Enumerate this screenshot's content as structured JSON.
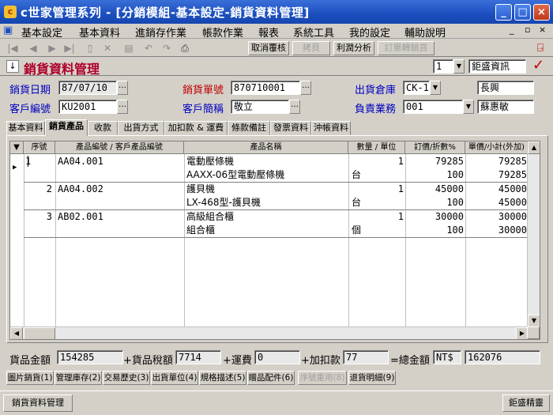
{
  "window": {
    "title": "c世家管理系列 - [分銷模組-基本設定-銷貨資料管理]",
    "app_icon": "c",
    "min_label": "_",
    "max_label": "□",
    "close_label": "×"
  },
  "menu": {
    "items": [
      "基本設定",
      "基本資料",
      "進銷存作業",
      "帳款作業",
      "報表",
      "系統工具",
      "我的設定",
      "輔助說明"
    ],
    "child_controls": [
      "_",
      "▫",
      "×"
    ]
  },
  "toolbar": {
    "icons": [
      "first-record-icon",
      "prev-record-icon",
      "next-record-icon",
      "last-record-icon",
      "new-icon",
      "delete-icon",
      "save-icon",
      "undo-icon",
      "redo-icon",
      "print-icon"
    ],
    "buttons": [
      {
        "label": "取消覆核",
        "enabled": true
      },
      {
        "label": "拷貝",
        "enabled": false
      },
      {
        "label": "利潤分析",
        "enabled": true
      },
      {
        "label": "訂單轉銷貨",
        "enabled": false
      }
    ]
  },
  "header": {
    "title": "銷貨資料管理",
    "record_no": "1",
    "company": "鉅盛資訊",
    "confirm_icon": "✓"
  },
  "form": {
    "sale_date_label": "銷貨日期",
    "sale_date": "87/07/10",
    "sale_no_label": "銷貨單號",
    "sale_no": "870710001",
    "warehouse_label": "出貨倉庫",
    "warehouse": "CK-1",
    "warehouse_name": "長興",
    "customer_no_label": "客戶編號",
    "customer_no": "KU2001",
    "customer_short_label": "客戶簡稱",
    "customer_short": "敬立",
    "sales_rep_label": "負責業務",
    "sales_rep": "001",
    "sales_rep_name": "蘇惠敏"
  },
  "tabs": [
    "基本資料",
    "銷貨產品",
    "收款",
    "出貨方式",
    "加扣款 & 運費",
    "條款備註",
    "發票資料",
    "沖帳資料"
  ],
  "grid": {
    "headers": [
      "序號",
      "產品編號 / 客戶產品編號",
      "產品名稱",
      "數量 / 單位",
      "訂價/折數%",
      "單價/小計(外加)"
    ],
    "rows": [
      {
        "seq": "1",
        "code": "AA04.001",
        "name": "電動壓條機",
        "qty": "1",
        "price": "79285",
        "subtotal": "79285"
      },
      {
        "seq": "",
        "code": "",
        "name": "AAXX-06型電動壓條機",
        "qty": "台",
        "price": "100",
        "subtotal": "79285"
      },
      {
        "seq": "2",
        "code": "AA04.002",
        "name": "護貝機",
        "qty": "1",
        "price": "45000",
        "subtotal": "45000"
      },
      {
        "seq": "",
        "code": "",
        "name": "LX-468型-護貝機",
        "qty": "台",
        "price": "100",
        "subtotal": "45000"
      },
      {
        "seq": "3",
        "code": "AB02.001",
        "name": "高級組合櫃",
        "qty": "1",
        "price": "30000",
        "subtotal": "30000"
      },
      {
        "seq": "",
        "code": "",
        "name": "組合櫃",
        "qty": "個",
        "price": "100",
        "subtotal": "30000"
      }
    ]
  },
  "totals": {
    "goods_label": "貨品金額",
    "goods": "154285",
    "tax_label": "+貨品稅額",
    "tax": "7714",
    "freight_label": "+運費",
    "freight": "0",
    "adjust_label": "+加扣款",
    "adjust": "77",
    "total_label": "=總金額",
    "currency": "NT$",
    "total": "162076"
  },
  "bottom_buttons": [
    {
      "label": "圖片銷貨(1)",
      "enabled": true
    },
    {
      "label": "管理庫存(2)",
      "enabled": true
    },
    {
      "label": "交易歷史(3)",
      "enabled": true
    },
    {
      "label": "出貨單位(4)",
      "enabled": true
    },
    {
      "label": "規格描述(5)",
      "enabled": true
    },
    {
      "label": "贈品配件(6)",
      "enabled": true
    },
    {
      "label": "序號重用(8)",
      "enabled": false
    },
    {
      "label": "退貨明細(9)",
      "enabled": true
    }
  ],
  "taskbar": {
    "task_label": "銷貨資料管理",
    "right_label": "鉅盛精靈"
  }
}
